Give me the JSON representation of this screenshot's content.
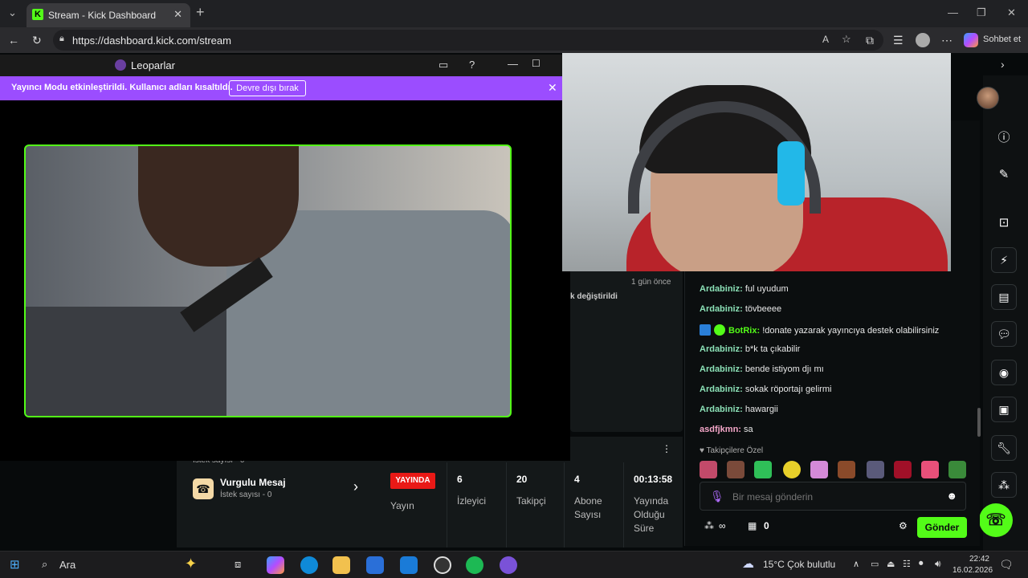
{
  "browser": {
    "tab_title": "Stream - Kick Dashboard",
    "url": "https://dashboard.kick.com/stream",
    "copilot_label": "Sohbet et"
  },
  "popup": {
    "title": "Leoparlar",
    "notice": "Yayıncı Modu etkinleştirildi. Kullanıcı adları kısaltıldı.",
    "notice_button": "Devre dışı bırak"
  },
  "activity": {
    "time": "1 gün önce",
    "text": "k değiştirildi"
  },
  "chat": {
    "messages": [
      {
        "user": "Ardabiniz",
        "text": "ful uyudum"
      },
      {
        "user": "Ardabiniz",
        "text": "tövbeeee"
      },
      {
        "user": "BotRix",
        "text": "!donate yazarak yayıncıya destek olabilirsiniz"
      },
      {
        "user": "Ardabiniz",
        "text": "b*k ta çıkabilir"
      },
      {
        "user": "Ardabiniz",
        "text": "bende istiyom djı mı"
      },
      {
        "user": "Ardabiniz",
        "text": "sokak röportajı gelirmi"
      },
      {
        "user": "Ardabiniz",
        "text": "hawargii"
      },
      {
        "user": "asdfjkmn",
        "text": "sa"
      }
    ],
    "emotes_label": "Takipçilere Özel",
    "input_placeholder": "Bir mesaj gönderin",
    "footer_points": "∞",
    "footer_count": "0",
    "send_label": "Gönder"
  },
  "highlight": {
    "title": "Vurgulu Mesaj",
    "subtitle": "İstek sayısı - 0",
    "above_subtitle": "İstek sayısı - 0"
  },
  "stats": {
    "live_badge": "YAYINDA",
    "stream_label": "Yayın",
    "viewers": "6",
    "viewers_label": "İzleyici",
    "followers": "20",
    "followers_label": "Takipçi",
    "subscribers": "4",
    "subscribers_label": "Abone Sayısı",
    "uptime": "00:13:58",
    "uptime_label": "Yayında Olduğu Süre"
  },
  "taskbar": {
    "search": "Ara",
    "weather": "15°C  Çok bulutlu",
    "time": "22:42",
    "date": "16.02.2026"
  }
}
